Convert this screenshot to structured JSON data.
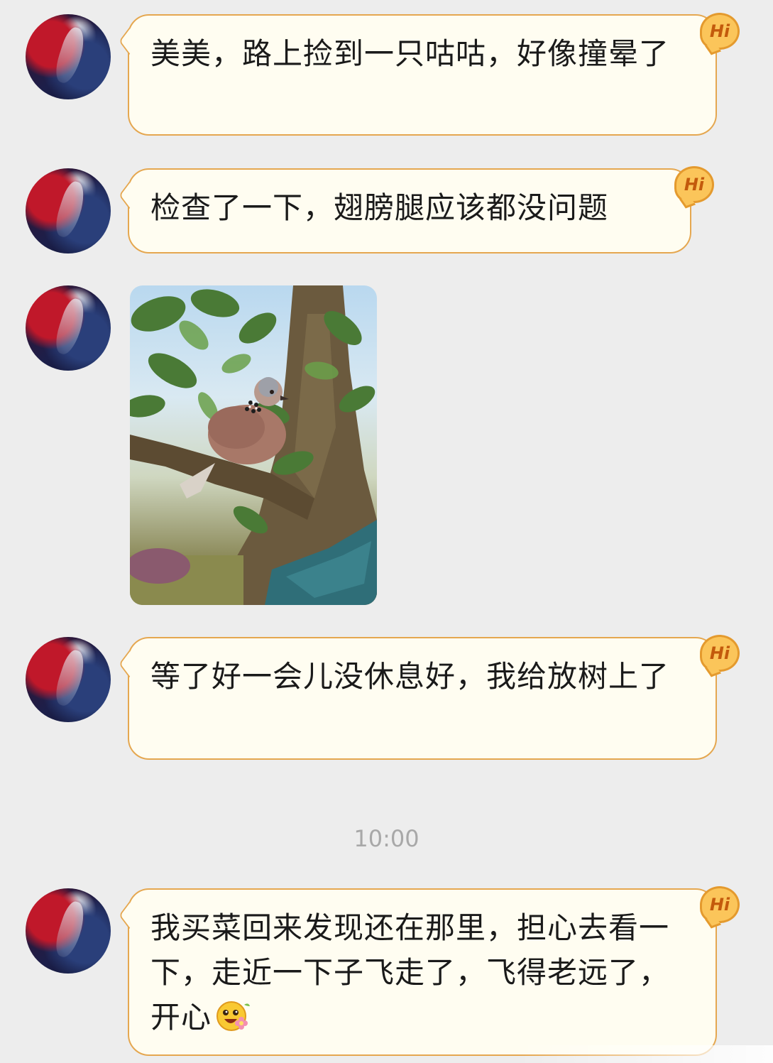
{
  "messages": [
    {
      "text": "美美，路上捡到一只咕咕，好像撞晕了",
      "badge": "Hi"
    },
    {
      "text": "检查了一下，翅膀腿应该都没问题",
      "badge": "Hi"
    },
    {
      "image": "photo of a spotted dove perched on a tree branch"
    },
    {
      "text": "等了好一会儿没休息好，我给放树上了",
      "badge": "Hi"
    },
    {
      "text": "我买菜回来发现还在那里，担心去看一下，走近一下子飞走了，飞得老远了，开心",
      "badge": "Hi",
      "emoji": "happy-flower-emoji"
    }
  ],
  "timestamp": "10:00",
  "colors": {
    "background": "#EDEDED",
    "bubble_fill": "#FFFDF1",
    "bubble_border": "#E5A750",
    "timestamp": "#A8A8A8"
  }
}
